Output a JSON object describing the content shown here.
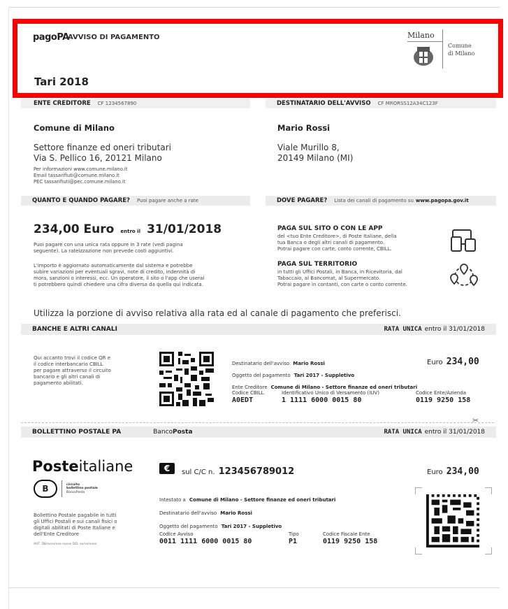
{
  "header": {
    "logo_text": "pagoPA",
    "doc_label": "AVVISO DI PAGAMENTO",
    "title": "Tari 2018",
    "comune_city": "Milano",
    "comune_name_l1": "Comune",
    "comune_name_l2": "di Milano",
    "highlight_color": "#ff0000"
  },
  "creditor_bar": {
    "label": "ENTE CREDITORE",
    "cf": "CF 1234567890"
  },
  "recipient_bar": {
    "label": "DESTINATARIO DELL'AVVISO",
    "cf": "CF MRORSS12A34C123F"
  },
  "creditor": {
    "name": "Comune di Milano",
    "addr1": "Settore finanze ed oneri tributari",
    "addr2": "Via S. Pellico 16, 20121 Milano",
    "info1": "Per informazioni www.comune.milano.it",
    "info2": "Email tassarifiuti@comune.milano.it",
    "info3": "PEC tassarifiuti@pec.comune.milano.it"
  },
  "recipient": {
    "name": "Mario Rossi",
    "addr1": "Viale Murillo 8,",
    "addr2": "20149 Milano (MI)"
  },
  "how_bar": {
    "label": "QUANTO E QUANDO PAGARE?",
    "note": "Puoi pagare anche a rate"
  },
  "where_bar": {
    "label": "DOVE PAGARE?",
    "note": "Lista dei canali di pagamento su",
    "link": "www.pagopa.gov.it"
  },
  "amount": {
    "value": "234,00 Euro",
    "entro": "entro il",
    "date": "31/01/2018",
    "text1": "Puoi pagare con una unica rata oppure in 3 rate (vedi pagina",
    "text2": "seguente). La rateizzazione non prevede costi aggiuntivi.",
    "text3": "L'importo è aggiornato automaticamente dal sistema e potrebbe",
    "text4": "subire variazioni per eventuali sgravi, note di credito, indennità di",
    "text5": "mora, sanzioni o interessi, ecc. Un operatore, il sito o l'app che userai",
    "text6": "ti potrebbero quindi chiedere una cifra diversa da quella qui indicata."
  },
  "where": {
    "app_title": "PAGA SUL SITO O CON LE APP",
    "app1": "del <tuo Ente Creditore>, di Poste Italiane, della",
    "app2": "tua Banca o degli altri canali di pagamento.",
    "app3": "Potrai pagare con carte, conto corrente, CBILL.",
    "terr_title": "PAGA SUL TERRITORIO",
    "terr1": "in tutti gli Uffici Postali, in Banca, in Ricevitoria, dal",
    "terr2": "Tabaccaio, al Bancomat, al Supermercato.",
    "terr3": "Potrai pagare in contanti, con carte o conto corrente.",
    "app_icon": "devices-icon",
    "terr_icon": "map-pins-icon"
  },
  "instruction": "Utilizza la porzione di avviso relativa alla rata ed al canale di pagamento che preferisci.",
  "bank_bar": {
    "label": "BANCHE E ALTRI CANALI",
    "rata": "RATA UNICA",
    "entro": "entro il 31/01/2018"
  },
  "bank": {
    "t1": "Qui accanto trovi il codice QR e",
    "t2": "il codice interbancario CBILL",
    "t3": "per pagare attraverso il circuito",
    "t4": "bancario e gli altri canali di",
    "t5": "pagamento abilitati.",
    "dest_label": "Destinatario dell'avviso",
    "dest_val": "Mario Rossi",
    "ogg_label": "Oggetto del pagamento",
    "ogg_val": "Tari 2017 - Suppletivo",
    "ente_label": "Ente Creditore",
    "ente_val": "Comune di Milano - Settore finanze ed oneri tributari",
    "euro_label": "Euro",
    "euro_val": "234,00",
    "cbill_label": "Codice CBILL",
    "cbill_val": "A0EDT",
    "iuv_label": "Identificativo Unico di Versamento (IUV)",
    "iuv_val": "1 1111 6000 0015 80",
    "cod_ente_label": "Codice Ente/Azienda",
    "cod_ente_val": "0119 9250 158"
  },
  "postal_bar": {
    "label": "BOLLETTINO POSTALE PA",
    "banco1": "Banco",
    "banco2": "Posta",
    "rata": "RATA UNICA",
    "entro": "entro il 31/01/2018"
  },
  "postal": {
    "poste_bold": "Poste",
    "poste_rest": "italiane",
    "cc_label": "sul C/C n.",
    "cc_val": "123456789012",
    "euro_label": "Euro",
    "euro_val": "234,00",
    "int_label": "Intestato a",
    "int_val": "Comune di Milano - Settore finanze ed oneri tributari",
    "dest_label": "Destinatario dell'avviso",
    "dest_val": "Mario Rossi",
    "ogg_label": "Oggetto del pagamento",
    "ogg_val": "Tari 2017 - Suppletivo",
    "avviso_label": "Codice Avviso",
    "avviso_val": "0011 1111 6000 0015 80",
    "tipo_label": "Tipo",
    "tipo_val": "P1",
    "cf_label": "Codice Fiscale Ente",
    "cf_val": "0119 9250 158",
    "left1": "Bollettino Postale pagabile in tutti",
    "left2": "gli Uffici Postali e sui canali fisici o",
    "left3": "digitali abilitati di Poste Italiane e",
    "left4": "dell'Ente Creditore",
    "aut": "AUT. DB/xxxx/xxx xxxxx DEL xx/xx/xxxx",
    "badge1": "circuito",
    "badge2": "bollettino postale",
    "badge3": "BancoPosta"
  }
}
